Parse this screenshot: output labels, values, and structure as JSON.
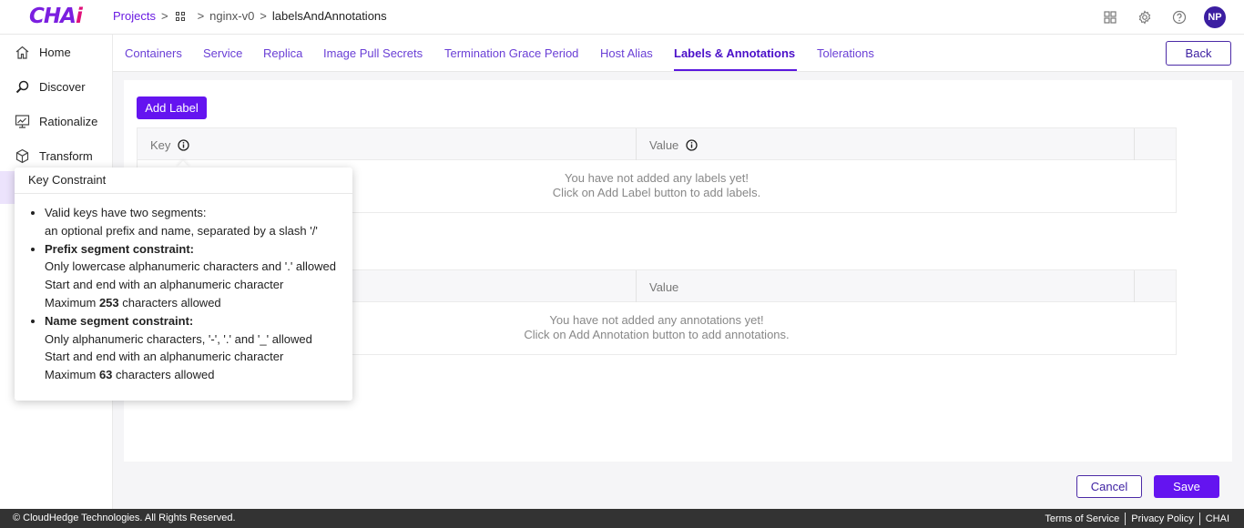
{
  "app": {
    "logo_main": "CHA",
    "logo_accent": "i"
  },
  "breadcrumb": {
    "projects": "Projects",
    "sep": ">",
    "project": "nginx-v0",
    "current": "labelsAndAnnotations"
  },
  "header": {
    "avatar_initials": "NP"
  },
  "sidebar": {
    "items": [
      {
        "label": "Home",
        "icon": "home-icon"
      },
      {
        "label": "Discover",
        "icon": "discover-icon"
      },
      {
        "label": "Rationalize",
        "icon": "rationalize-icon"
      },
      {
        "label": "Transform",
        "icon": "transform-icon"
      }
    ]
  },
  "tabs": [
    {
      "label": "Containers"
    },
    {
      "label": "Service"
    },
    {
      "label": "Replica"
    },
    {
      "label": "Image Pull Secrets"
    },
    {
      "label": "Termination Grace Period"
    },
    {
      "label": "Host Alias"
    },
    {
      "label": "Labels & Annotations",
      "active": true
    },
    {
      "label": "Tolerations"
    }
  ],
  "back_label": "Back",
  "labels": {
    "add_button": "Add Label",
    "col_key": "Key",
    "col_value": "Value",
    "empty_line1": "You have not added any labels yet!",
    "empty_line2": "Click on Add Label button to add labels."
  },
  "annotations": {
    "col_value": "Value",
    "empty_line1": "You have not added any annotations yet!",
    "empty_line2": "Click on Add Annotation button to add annotations."
  },
  "actions": {
    "cancel": "Cancel",
    "save": "Save"
  },
  "footer": {
    "copyright": "© CloudHedge Technologies. All Rights Reserved.",
    "terms": "Terms of Service",
    "privacy": "Privacy Policy",
    "brand": "CHAI"
  },
  "tooltip": {
    "title": "Key Constraint",
    "b1_l1": "Valid keys have two segments:",
    "b1_l2": "an optional prefix and name, separated by a slash '/'",
    "b2_head": "Prefix segment constraint:",
    "b2_l1": "Only lowercase alphanumeric characters and '.' allowed",
    "b2_l2": "Start and end with an alphanumeric character",
    "b2_l3_pre": "Maximum ",
    "b2_l3_num": "253",
    "b2_l3_post": " characters allowed",
    "b3_head": "Name segment constraint:",
    "b3_l1": "Only alphanumeric characters, '-', '.' and '_' allowed",
    "b3_l2": "Start and end with an alphanumeric character",
    "b3_l3_pre": "Maximum ",
    "b3_l3_num": "63",
    "b3_l3_post": " characters allowed"
  },
  "colors": {
    "accent": "#6414f0",
    "brand_pink": "#e0117a",
    "avatar_bg": "#3b1ea1",
    "footer_bg": "#333333"
  }
}
